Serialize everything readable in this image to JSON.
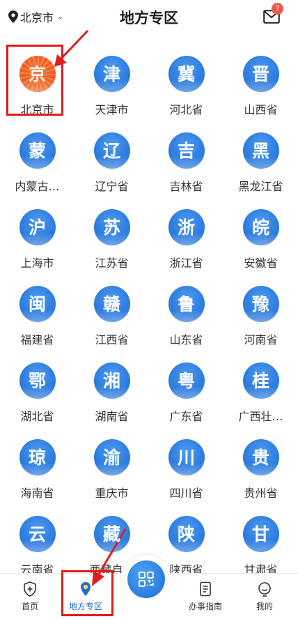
{
  "header": {
    "location": "北京市",
    "title": "地方专区",
    "badge_count": "7"
  },
  "regions": [
    {
      "glyph": "京",
      "label": "北京市",
      "color": "orange"
    },
    {
      "glyph": "津",
      "label": "天津市",
      "color": "blue"
    },
    {
      "glyph": "冀",
      "label": "河北省",
      "color": "blue"
    },
    {
      "glyph": "晋",
      "label": "山西省",
      "color": "blue"
    },
    {
      "glyph": "蒙",
      "label": "内蒙古…",
      "color": "blue"
    },
    {
      "glyph": "辽",
      "label": "辽宁省",
      "color": "blue"
    },
    {
      "glyph": "吉",
      "label": "吉林省",
      "color": "blue"
    },
    {
      "glyph": "黑",
      "label": "黑龙江省",
      "color": "blue"
    },
    {
      "glyph": "沪",
      "label": "上海市",
      "color": "blue"
    },
    {
      "glyph": "苏",
      "label": "江苏省",
      "color": "blue"
    },
    {
      "glyph": "浙",
      "label": "浙江省",
      "color": "blue"
    },
    {
      "glyph": "皖",
      "label": "安徽省",
      "color": "blue"
    },
    {
      "glyph": "闽",
      "label": "福建省",
      "color": "blue"
    },
    {
      "glyph": "赣",
      "label": "江西省",
      "color": "blue"
    },
    {
      "glyph": "鲁",
      "label": "山东省",
      "color": "blue"
    },
    {
      "glyph": "豫",
      "label": "河南省",
      "color": "blue"
    },
    {
      "glyph": "鄂",
      "label": "湖北省",
      "color": "blue"
    },
    {
      "glyph": "湘",
      "label": "湖南省",
      "color": "blue"
    },
    {
      "glyph": "粤",
      "label": "广东省",
      "color": "blue"
    },
    {
      "glyph": "桂",
      "label": "广西壮…",
      "color": "blue"
    },
    {
      "glyph": "琼",
      "label": "海南省",
      "color": "blue"
    },
    {
      "glyph": "渝",
      "label": "重庆市",
      "color": "blue"
    },
    {
      "glyph": "川",
      "label": "四川省",
      "color": "blue"
    },
    {
      "glyph": "贵",
      "label": "贵州省",
      "color": "blue"
    },
    {
      "glyph": "云",
      "label": "云南省",
      "color": "blue"
    },
    {
      "glyph": "藏",
      "label": "西藏自…",
      "color": "blue"
    },
    {
      "glyph": "陕",
      "label": "陕西省",
      "color": "blue"
    },
    {
      "glyph": "甘",
      "label": "甘肃省",
      "color": "blue"
    }
  ],
  "nav": {
    "home": "首页",
    "local": "地方专区",
    "guide": "办事指南",
    "mine": "我的"
  },
  "colors": {
    "accent_blue": "#1f6fd6",
    "beijing_orange": "#ee5a20",
    "annotation_red": "#e21b1b",
    "badge_red": "#f0584a"
  }
}
